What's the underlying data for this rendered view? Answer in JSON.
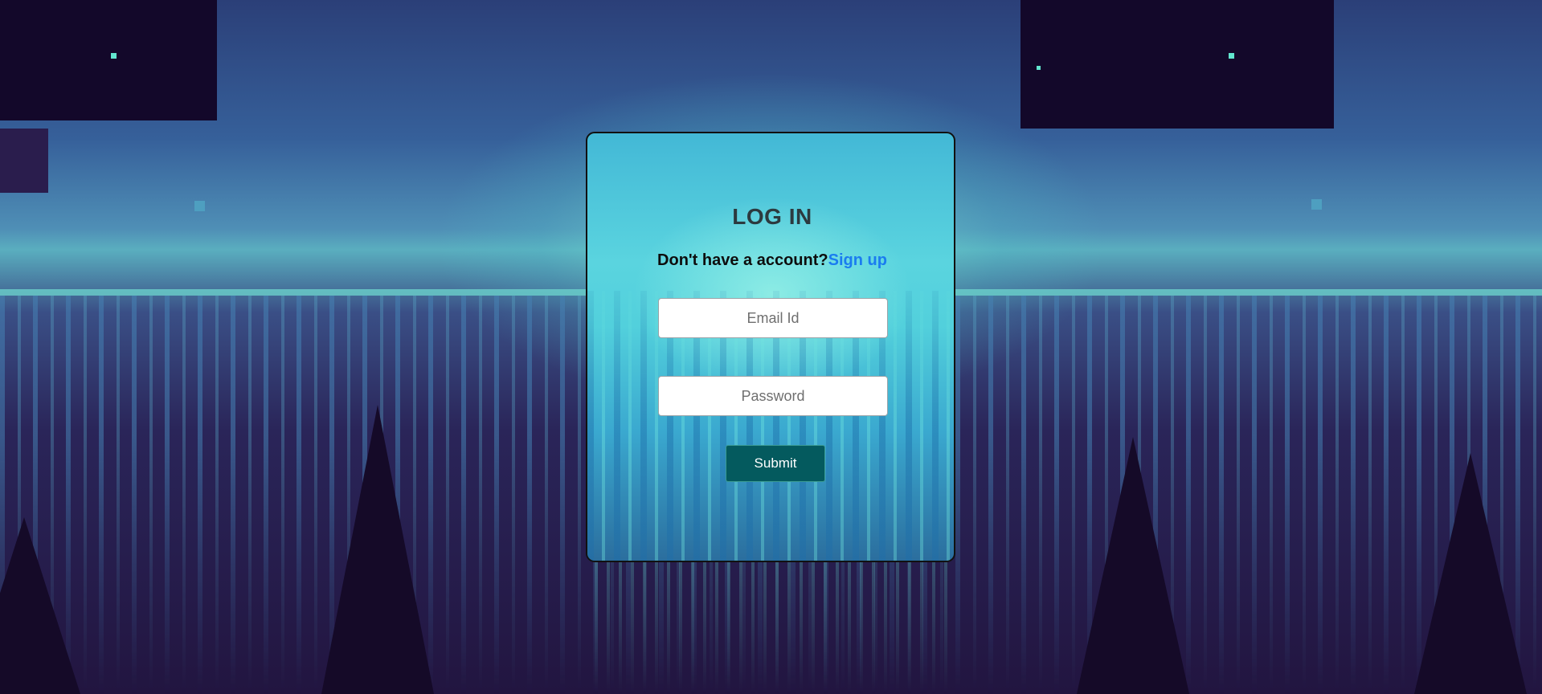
{
  "login": {
    "title": "LOG IN",
    "signup_prompt": "Don't have a account?",
    "signup_link": "Sign up",
    "email_placeholder": "Email Id",
    "email_value": "",
    "password_placeholder": "Password",
    "password_value": "",
    "submit_label": "Submit"
  },
  "colors": {
    "submit_background": "#045a5e",
    "link": "#1a7cf0",
    "title_text": "#2c3a3f"
  }
}
